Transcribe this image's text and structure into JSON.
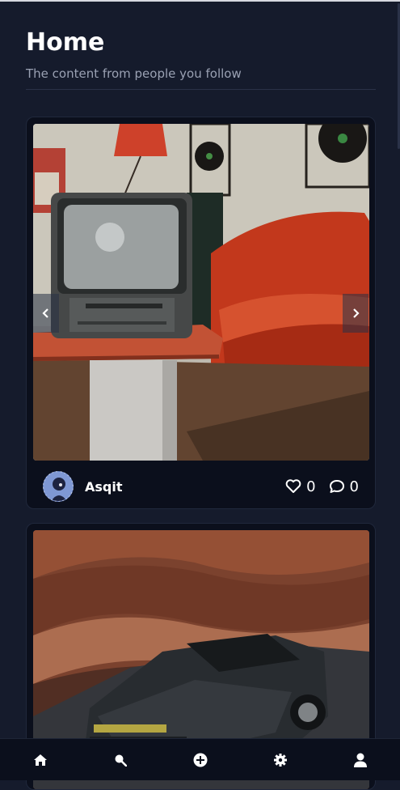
{
  "header": {
    "title": "Home",
    "subtitle": "The content from people you follow"
  },
  "posts": [
    {
      "author": "Asqit",
      "likes": "0",
      "comments": "0",
      "image_icon": "retro-tv-red-sofa-photo"
    },
    {
      "image_icon": "dark-bmw-car-canyon-photo"
    }
  ],
  "nav": {
    "items": [
      "home-icon",
      "search-icon",
      "add-circle-icon",
      "gear-icon",
      "user-icon"
    ]
  },
  "colors": {
    "background": "#151b2c",
    "card": "#0b0f1c",
    "muted_text": "#9aa1b3"
  }
}
